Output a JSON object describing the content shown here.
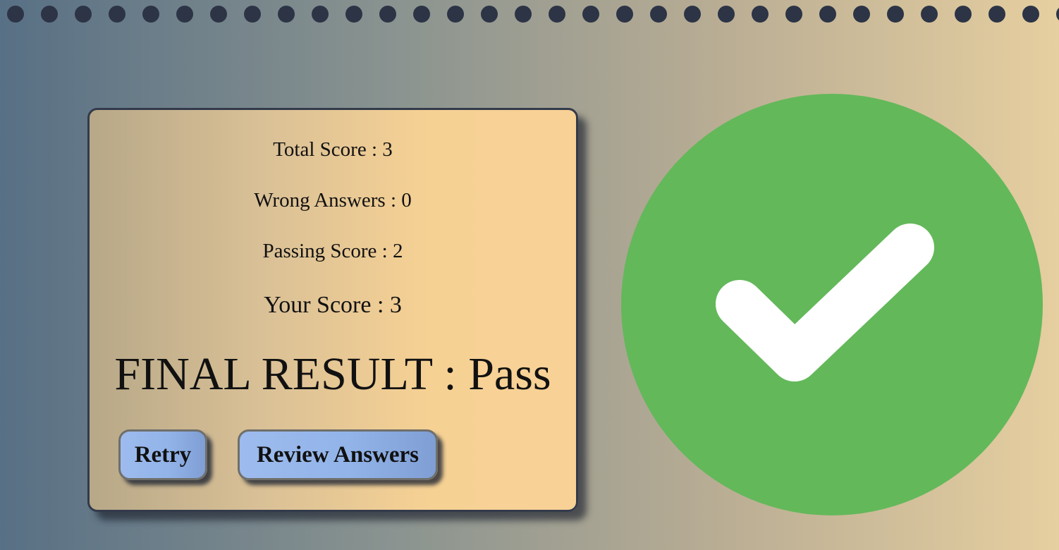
{
  "colors": {
    "dot_color": "#2c3446",
    "card_border": "#333a4b",
    "button_blue": "#92b4e9",
    "check_green": "#63b85a",
    "check_mark": "#ffffff"
  },
  "decorations": {
    "top_dot_count": 32,
    "top_dot_icon": "dot-icon"
  },
  "results": {
    "total_score": "Total Score : 3",
    "wrong_answers": "Wrong Answers : 0",
    "passing_score": "Passing Score : 2",
    "your_score": "Your Score : 3",
    "final_result": "FINAL RESULT : Pass"
  },
  "actions": {
    "retry_label": "Retry",
    "review_label": "Review Answers"
  },
  "status_icon": {
    "name": "checkmark-circle-icon",
    "state": "pass"
  }
}
